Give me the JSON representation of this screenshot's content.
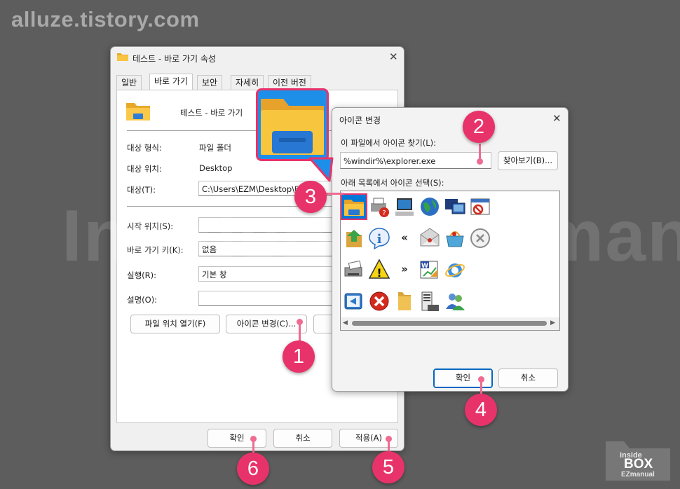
{
  "site_watermark": "alluze.tistory.com",
  "background_watermark": "InsideBOXEZmanual",
  "brand_logo": {
    "line1": "inside",
    "line2": "BOX",
    "line3": "EZmanual"
  },
  "properties_dialog": {
    "title": "테스트 - 바로 가기 속성",
    "tabs": [
      "일반",
      "바로 가기",
      "보안",
      "자세히",
      "이전 버전"
    ],
    "active_tab": "바로 가기",
    "shortcut_name": "테스트 - 바로 가기",
    "fields": {
      "target_type_label": "대상 형식:",
      "target_type_value": "파일 폴더",
      "target_location_label": "대상 위치:",
      "target_location_value": "Desktop",
      "target_label": "대상(T):",
      "target_value": "C:\\Users\\EZM\\Desktop\\테스트",
      "start_in_label": "시작 위치(S):",
      "start_in_value": "",
      "shortcut_key_label": "바로 가기 키(K):",
      "shortcut_key_value": "없음",
      "run_label": "실행(R):",
      "run_value": "기본 창",
      "comment_label": "설명(O):",
      "comment_value": ""
    },
    "buttons": {
      "open_location": "파일 위치 열기(F)",
      "change_icon": "아이콘 변경(C)...",
      "ok": "확인",
      "cancel": "취소",
      "apply": "적용(A)"
    }
  },
  "change_icon_dialog": {
    "title": "아이콘 변경",
    "search_label": "이 파일에서 아이콘 찾기(L):",
    "path_value": "%windir%\\explorer.exe",
    "browse_button": "찾아보기(B)...",
    "list_label": "아래 목록에서 아이콘 선택(S):",
    "icons": [
      "folder-icon",
      "printer-help-icon",
      "computer-icon",
      "globe-icon",
      "monitors-icon",
      "no-entry-window-icon",
      "folder-arrow-icon",
      "info-icon",
      "double-chevron-left-icon",
      "mail-icon",
      "shopping-basket-icon",
      "cancel-circle-icon",
      "printer-icon",
      "warning-icon",
      "double-chevron-right-icon",
      "document-chart-icon",
      "ie-globe-icon",
      "blue-arrow-icon",
      "red-x-icon",
      "yellow-folder-icon",
      "server-list-icon",
      "users-icon"
    ],
    "selected_icon": "folder-icon",
    "buttons": {
      "ok": "확인",
      "cancel": "취소"
    }
  },
  "step_markers": [
    "1",
    "2",
    "3",
    "4",
    "5",
    "6"
  ],
  "colors": {
    "marker": "#e8336a",
    "accent": "#0067c0",
    "selection": "#0078d7"
  }
}
